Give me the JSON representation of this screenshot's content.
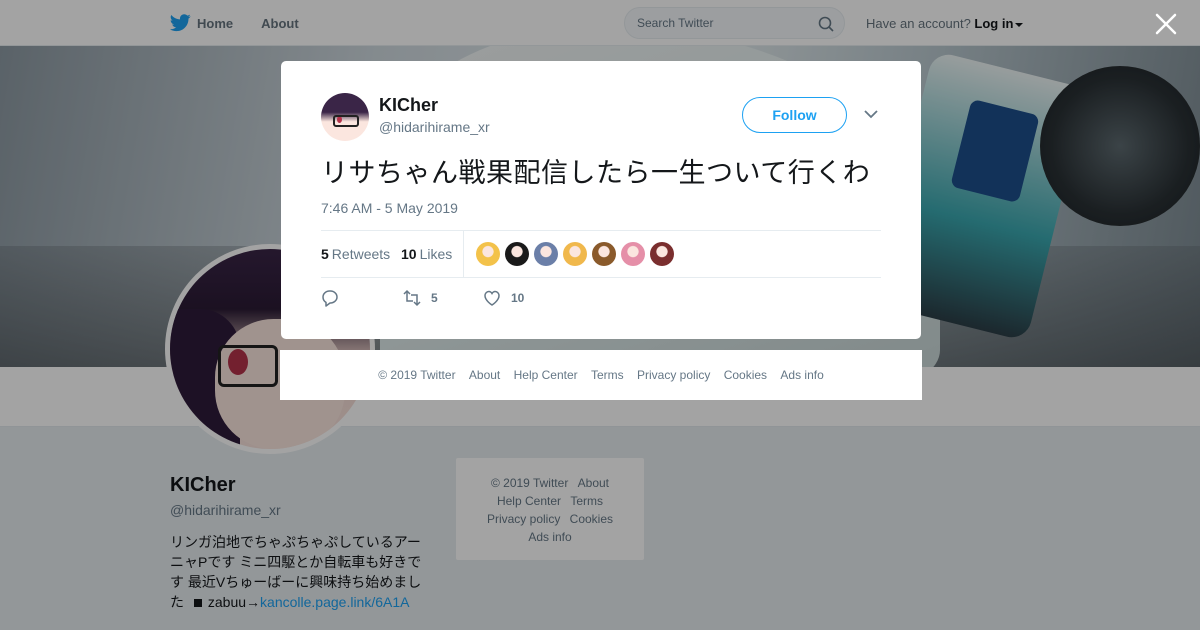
{
  "nav": {
    "home": "Home",
    "about": "About",
    "search_placeholder": "Search Twitter",
    "account_prompt": "Have an account?",
    "login": "Log in"
  },
  "profile": {
    "name": "KICher",
    "handle": "@hidarihirame_xr",
    "bio_text": "リンガ泊地でちゃぷちゃぷしているアーニャPです ミニ四駆とか自転車も好きです 最近Vちゅーばーに興味持ち始めました",
    "bio_zabuu": "zabuu→",
    "bio_link": "kancolle.page.link/6A1A"
  },
  "side_footer": {
    "copyright": "© 2019 Twitter",
    "about": "About",
    "help": "Help Center",
    "terms": "Terms",
    "privacy": "Privacy policy",
    "cookies": "Cookies",
    "ads": "Ads info"
  },
  "tweet": {
    "author_name": "KICher",
    "author_handle": "@hidarihirame_xr",
    "follow_label": "Follow",
    "text": "リサちゃん戦果配信したら一生ついて行くわ",
    "timestamp": "7:46 AM - 5 May 2019",
    "retweets_count": "5",
    "retweets_label": "Retweets",
    "likes_count": "10",
    "likes_label": "Likes",
    "reply_count": "",
    "retweet_action_count": "5",
    "like_action_count": "10",
    "liker_colors": [
      "#f3c24a",
      "#1a1a1a",
      "#6b7fa8",
      "#f0b84c",
      "#8a5a2b",
      "#e58fa8",
      "#7a2e2e"
    ]
  },
  "footer": {
    "copyright": "© 2019 Twitter",
    "about": "About",
    "help": "Help Center",
    "terms": "Terms",
    "privacy": "Privacy policy",
    "cookies": "Cookies",
    "ads": "Ads info"
  },
  "colors": {
    "accent": "#1da1f2",
    "text_secondary": "#657786"
  }
}
